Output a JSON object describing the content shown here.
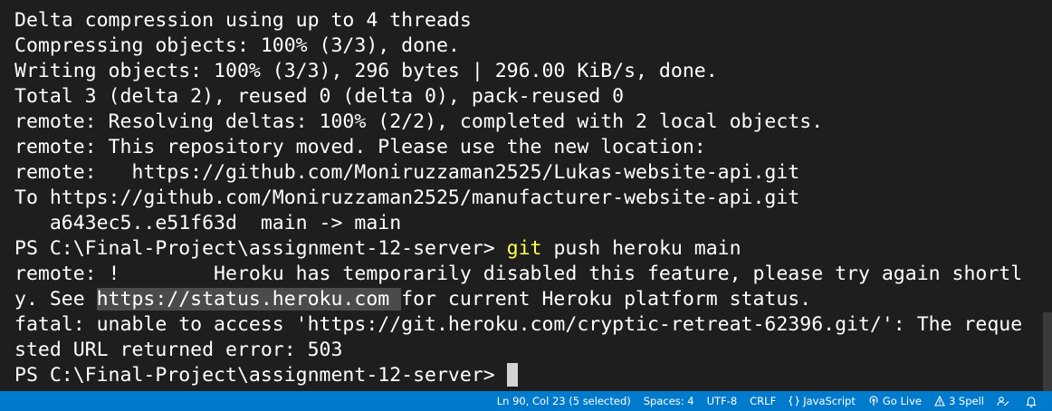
{
  "terminal": {
    "lines": [
      "Delta compression using up to 4 threads",
      "Compressing objects: 100% (3/3), done.",
      "Writing objects: 100% (3/3), 296 bytes | 296.00 KiB/s, done.",
      "Total 3 (delta 2), reused 0 (delta 0), pack-reused 0",
      "remote: Resolving deltas: 100% (2/2), completed with 2 local objects.",
      "remote: This repository moved. Please use the new location:",
      "remote:   https://github.com/Moniruzzaman2525/Lukas-website-api.git",
      "To https://github.com/Moniruzzaman2525/manufacturer-website-api.git",
      "   a643ec5..e51f63d  main -> main"
    ],
    "prompt1": "PS C:\\Final-Project\\assignment-12-server> ",
    "command": "git",
    "command_args": " push heroku main",
    "heroku_line1": "remote: !        Heroku has temporarily disabled this feature, please try again shortl",
    "heroku_line2_pre": "y. See ",
    "heroku_link": "https://status.heroku.com ",
    "heroku_line2_post": "for current Heroku platform status.",
    "fatal_line1": "fatal: unable to access 'https://git.heroku.com/cryptic-retreat-62396.git/': The reque",
    "fatal_line2": "sted URL returned error: 503",
    "prompt2": "PS C:\\Final-Project\\assignment-12-server> "
  },
  "statusbar": {
    "position": "Ln 90, Col 23 (5 selected)",
    "spaces": "Spaces: 4",
    "encoding": "UTF-8",
    "eol": "CRLF",
    "language": "JavaScript",
    "golive": "Go Live",
    "spell": "3 Spell",
    "icons": [
      "braces-icon",
      "broadcast-icon",
      "warning-icon",
      "feedback-icon",
      "bell-icon"
    ]
  },
  "colors": {
    "background": "#1e1e1e",
    "text": "#ffffff",
    "command": "#ffff55",
    "link_highlight": "#4b4b4b",
    "statusbar": "#007acc"
  }
}
